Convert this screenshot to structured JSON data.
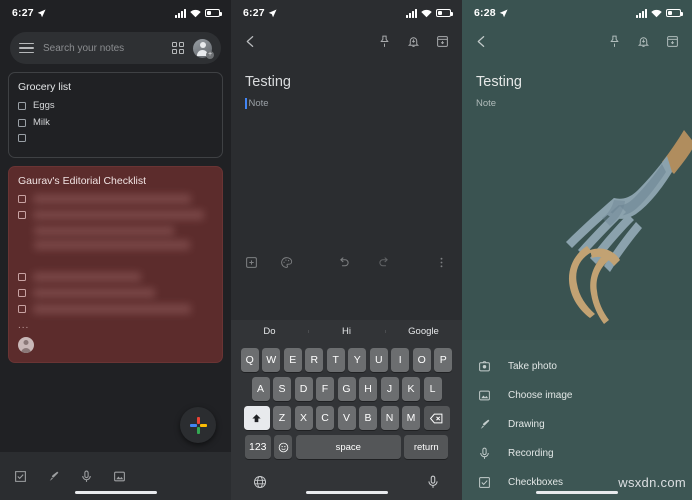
{
  "panels": {
    "notes_list": {
      "status": {
        "time": "6:27",
        "location_icon": "location-arrow-icon",
        "signal_icon": "signal-bars-icon",
        "wifi_icon": "wifi-icon",
        "battery_icon": "battery-icon"
      },
      "search": {
        "placeholder": "Search your notes",
        "menu_icon": "hamburger-menu-icon",
        "view_icon": "grid-view-icon",
        "account_icon": "account-avatar-icon"
      },
      "notes": [
        {
          "title": "Grocery list",
          "color": "#202124",
          "items": [
            {
              "label": "Eggs",
              "checked": false
            },
            {
              "label": "Milk",
              "checked": false
            },
            {
              "label": "",
              "checked": false
            }
          ]
        },
        {
          "title": "Gaurav's Editorial Checklist",
          "color": "#5c2c2c",
          "blurred": true,
          "overflow_indicator": "...",
          "collaborator_icon": "collaborator-avatar-icon",
          "items": [
            {
              "label": "",
              "checked": false
            },
            {
              "label": "",
              "checked": false
            },
            {
              "label": "",
              "checked": false
            },
            {
              "label": "",
              "checked": false
            },
            {
              "label": "",
              "checked": false
            }
          ]
        }
      ],
      "fab": {
        "icon": "google-plus-icon",
        "label": ""
      },
      "bottom_tools": [
        {
          "icon": "checkbox-icon",
          "label": "New list"
        },
        {
          "icon": "brush-icon",
          "label": "New drawing"
        },
        {
          "icon": "microphone-icon",
          "label": "New recording"
        },
        {
          "icon": "image-icon",
          "label": "New note with image"
        }
      ]
    },
    "note_editor": {
      "status": {
        "time": "6:27"
      },
      "toolbar": {
        "back_icon": "back-arrow-icon",
        "pin_icon": "pin-icon",
        "reminder_icon": "bell-reminder-icon",
        "archive_icon": "archive-icon"
      },
      "title": "Testing",
      "body_placeholder": "Note",
      "edit_tools": {
        "add_icon": "add-box-icon",
        "palette_icon": "color-palette-icon",
        "undo_icon": "undo-icon",
        "redo_icon": "redo-icon",
        "more_icon": "more-vertical-icon"
      },
      "keyboard": {
        "suggestions": [
          "Do",
          "Hi",
          "Google"
        ],
        "row1": [
          "Q",
          "W",
          "E",
          "R",
          "T",
          "Y",
          "U",
          "I",
          "O",
          "P"
        ],
        "row2": [
          "A",
          "S",
          "D",
          "F",
          "G",
          "H",
          "J",
          "K",
          "L"
        ],
        "row3": [
          "Z",
          "X",
          "C",
          "V",
          "B",
          "N",
          "M"
        ],
        "shift_label": "shift-key",
        "backspace_label": "backspace-key",
        "numbers_label": "123",
        "emoji_label": "emoji-key",
        "space_label": "space",
        "return_label": "return",
        "globe_label": "globe-key",
        "dictation_label": "dictation-key"
      }
    },
    "note_options": {
      "status": {
        "time": "6:28"
      },
      "toolbar": {
        "back_icon": "back-arrow-icon",
        "pin_icon": "pin-icon",
        "reminder_icon": "bell-reminder-icon",
        "archive_icon": "archive-icon"
      },
      "title": "Testing",
      "body_placeholder": "Note",
      "background_color": "#3a5351",
      "illustration": "fork-with-spaghetti-illustration",
      "sheet_items": [
        {
          "icon": "camera-icon",
          "label": "Take photo"
        },
        {
          "icon": "image-icon",
          "label": "Choose image"
        },
        {
          "icon": "brush-icon",
          "label": "Drawing"
        },
        {
          "icon": "microphone-icon",
          "label": "Recording"
        },
        {
          "icon": "checkbox-icon",
          "label": "Checkboxes"
        }
      ],
      "watermark": "wsxdn.com"
    }
  }
}
